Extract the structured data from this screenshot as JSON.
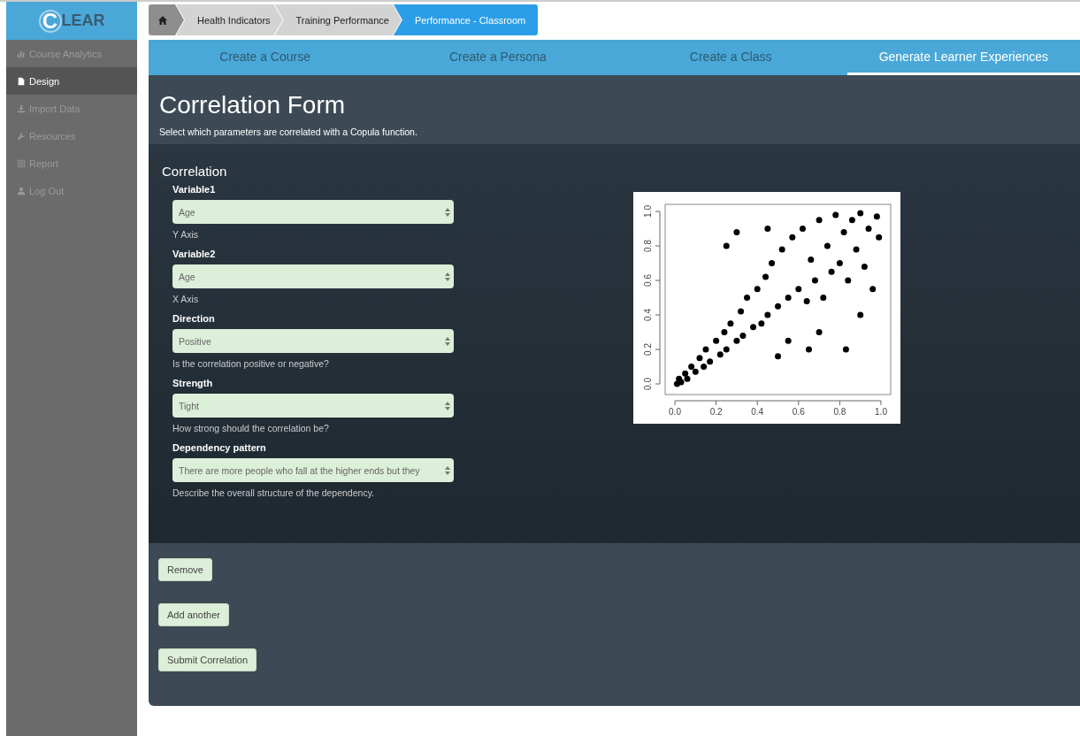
{
  "sidebar": {
    "logo": "LEAR",
    "logo_initial": "C",
    "items": [
      {
        "label": "Course Analytics",
        "selected": false
      },
      {
        "label": "Design",
        "selected": true
      },
      {
        "label": "Import Data",
        "selected": false
      },
      {
        "label": "Resources",
        "selected": false
      },
      {
        "label": "Report",
        "selected": false
      },
      {
        "label": "Log Out",
        "selected": false
      }
    ]
  },
  "breadcrumb": [
    {
      "label": "Health Indicators",
      "selected": false
    },
    {
      "label": "Training Performance",
      "selected": false
    },
    {
      "label": "Performance - Classroom",
      "selected": true
    }
  ],
  "tabs": [
    {
      "label": "Create a Course",
      "selected": false
    },
    {
      "label": "Create a Persona",
      "selected": false
    },
    {
      "label": "Create a Class",
      "selected": false
    },
    {
      "label": "Generate Learner Experiences",
      "selected": true
    }
  ],
  "header": {
    "title": "Correlation Form",
    "subtitle": "Select which parameters are correlated with a Copula function."
  },
  "form": {
    "title": "Correlation",
    "fields": [
      {
        "label": "Variable1",
        "value": "Age",
        "help": "Y Axis"
      },
      {
        "label": "Variable2",
        "value": "Age",
        "help": "X Axis"
      },
      {
        "label": "Direction",
        "value": "Positive",
        "help": "Is the correlation positive or negative?"
      },
      {
        "label": "Strength",
        "value": "Tight",
        "help": "How strong should the correlation be?"
      },
      {
        "label": "Dependency pattern",
        "value": "There are more people who fall at the higher ends but they",
        "help": "Describe the overall structure of the dependency."
      }
    ]
  },
  "chart_data": {
    "type": "scatter",
    "xlim": [
      0,
      1
    ],
    "ylim": [
      0,
      1
    ],
    "xticks": [
      {
        "value": 0,
        "label": "0.0"
      },
      {
        "value": 0.2,
        "label": "0.2"
      },
      {
        "value": 0.4,
        "label": "0.4"
      },
      {
        "value": 0.6,
        "label": "0.6"
      },
      {
        "value": 0.8,
        "label": "0.8"
      },
      {
        "value": 1,
        "label": "1.0"
      }
    ],
    "yticks": [
      {
        "value": 0,
        "label": "0.0"
      },
      {
        "value": 0.2,
        "label": "0.2"
      },
      {
        "value": 0.4,
        "label": "0.4"
      },
      {
        "value": 0.6,
        "label": "0.6"
      },
      {
        "value": 0.8,
        "label": "0.8"
      },
      {
        "value": 1,
        "label": "1.0"
      }
    ],
    "x": [
      0.01,
      0.02,
      0.03,
      0.05,
      0.06,
      0.08,
      0.1,
      0.12,
      0.14,
      0.15,
      0.17,
      0.2,
      0.22,
      0.24,
      0.25,
      0.27,
      0.3,
      0.32,
      0.33,
      0.35,
      0.38,
      0.4,
      0.42,
      0.44,
      0.45,
      0.47,
      0.5,
      0.52,
      0.55,
      0.57,
      0.6,
      0.62,
      0.64,
      0.66,
      0.68,
      0.7,
      0.72,
      0.74,
      0.76,
      0.78,
      0.8,
      0.82,
      0.84,
      0.86,
      0.88,
      0.9,
      0.92,
      0.94,
      0.96,
      0.98,
      0.99,
      0.25,
      0.3,
      0.45,
      0.5,
      0.55,
      0.65,
      0.7,
      0.83,
      0.9
    ],
    "series": [
      {
        "color": "#000000",
        "values": [
          0.0,
          0.03,
          0.01,
          0.06,
          0.03,
          0.1,
          0.07,
          0.15,
          0.1,
          0.2,
          0.13,
          0.25,
          0.17,
          0.3,
          0.2,
          0.35,
          0.25,
          0.42,
          0.28,
          0.5,
          0.33,
          0.55,
          0.35,
          0.62,
          0.4,
          0.7,
          0.45,
          0.78,
          0.5,
          0.85,
          0.55,
          0.9,
          0.48,
          0.72,
          0.6,
          0.95,
          0.5,
          0.8,
          0.65,
          0.98,
          0.7,
          0.88,
          0.6,
          0.95,
          0.78,
          0.99,
          0.68,
          0.9,
          0.55,
          0.97,
          0.85,
          0.8,
          0.88,
          0.9,
          0.16,
          0.25,
          0.2,
          0.3,
          0.2,
          0.4
        ]
      }
    ]
  },
  "buttons": [
    "Remove",
    "Add another",
    "Submit Correlation"
  ]
}
